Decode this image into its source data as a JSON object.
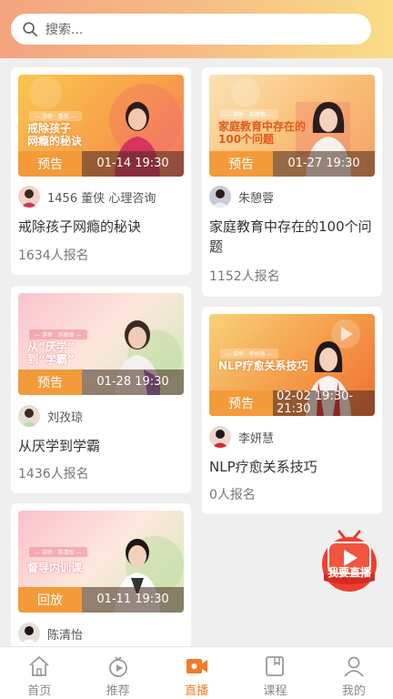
{
  "search": {
    "placeholder": "搜索..."
  },
  "cards": [
    {
      "thumb_title": "戒除孩子网瘾的秘诀",
      "thumb_title_lines": [
        "戒除孩子",
        "网瘾的秘诀"
      ],
      "status": "预告",
      "time": "01-14 19:30",
      "host": "1456 董侠 心理咨询",
      "title": "戒除孩子网瘾的秘诀",
      "signups": "1634人报名"
    },
    {
      "thumb_title_lines": [
        "家庭教育中存在的",
        "100个问题"
      ],
      "status": "预告",
      "time": "01-27 19:30",
      "host": "朱憩蓉",
      "title": "家庭教育中存在的100个问题",
      "signups": "1152人报名"
    },
    {
      "thumb_title_lines": [
        "从“厌学”",
        "到“学霸”"
      ],
      "status": "预告",
      "time": "01-28 19:30",
      "host": "刘孜琼",
      "title": "从厌学到学霸",
      "signups": "1436人报名"
    },
    {
      "thumb_title_lines": [
        "NLP疗愈关系技巧"
      ],
      "status": "预告",
      "time": "02-02 19:30-21:30",
      "host": "李妍慧",
      "title": "NLP疗愈关系技巧",
      "signups": "0人报名"
    },
    {
      "thumb_title_lines": [
        "督导内训课"
      ],
      "status": "回放",
      "time": "01-11 19:30",
      "host": "陈清怡"
    }
  ],
  "live_button": {
    "label": "我要直播"
  },
  "nav": [
    {
      "label": "首页",
      "icon": "home-icon"
    },
    {
      "label": "推荐",
      "icon": "recommend-icon"
    },
    {
      "label": "直播",
      "icon": "live-icon",
      "active": true
    },
    {
      "label": "课程",
      "icon": "course-icon"
    },
    {
      "label": "我的",
      "icon": "profile-icon"
    }
  ],
  "colors": {
    "accent": "#f07d26",
    "badge": "#f39a3a"
  }
}
